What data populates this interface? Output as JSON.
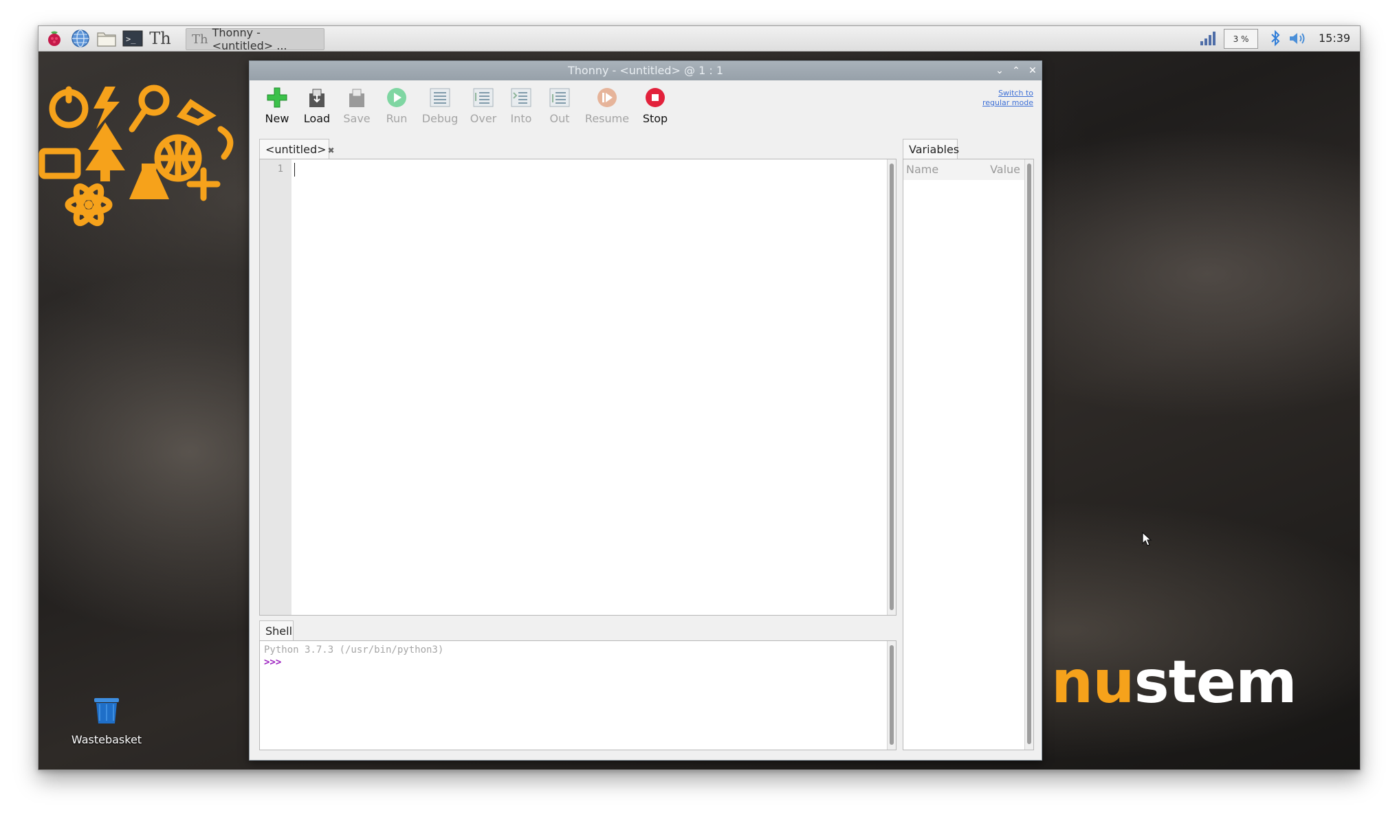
{
  "taskbar": {
    "launcher_icons": [
      "raspberry-menu-icon",
      "web-browser-icon",
      "file-manager-icon",
      "terminal-icon",
      "thonny-icon"
    ],
    "active_task_label": "Thonny  -  <untitled>  ...",
    "cpu_usage": "3 %",
    "clock": "15:39"
  },
  "window": {
    "title": "Thonny  -  <untitled>  @  1 : 1",
    "switch_mode_line1": "Switch to",
    "switch_mode_line2": "regular mode"
  },
  "toolbar": {
    "new": "New",
    "load": "Load",
    "save": "Save",
    "run": "Run",
    "debug": "Debug",
    "over": "Over",
    "into": "Into",
    "out": "Out",
    "resume": "Resume",
    "stop": "Stop"
  },
  "editor": {
    "tab_label": "<untitled>",
    "tab_close": "✖",
    "line_number": "1"
  },
  "shell": {
    "tab_label": "Shell",
    "banner": "Python 3.7.3 (/usr/bin/python3)",
    "prompt": ">>>"
  },
  "variables": {
    "tab_label": "Variables",
    "col_name": "Name",
    "col_value": "Value"
  },
  "desktop": {
    "wastebasket_label": "Wastebasket",
    "brand_part1": "nu",
    "brand_part2": "stem",
    "brand_colors": {
      "orange": "#f6a21b",
      "white": "#ffffff"
    }
  }
}
